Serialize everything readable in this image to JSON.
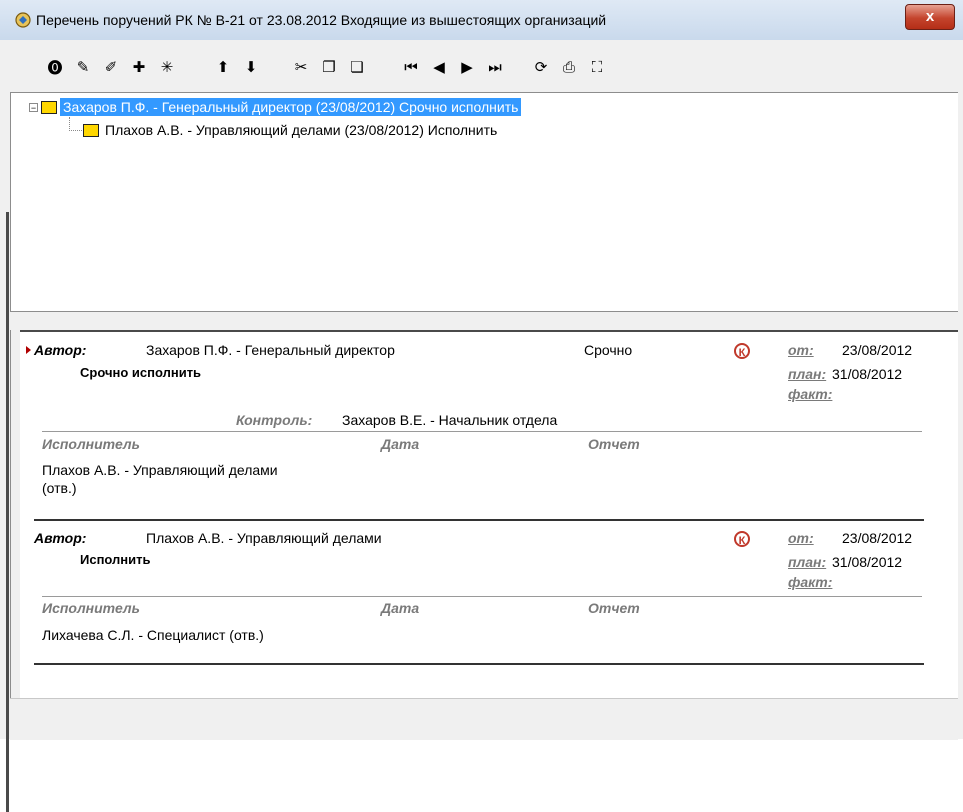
{
  "window": {
    "title": "Перечень поручений РК № В-21 от 23.08.2012 Входящие из вышестоящих организаций",
    "close_label": "x"
  },
  "toolbar": {
    "buttons": [
      {
        "name": "new-task-icon",
        "glyph": "⓿"
      },
      {
        "name": "new-subtask-icon",
        "glyph": "✎"
      },
      {
        "name": "edit-icon",
        "glyph": "✐"
      },
      {
        "name": "save-icon",
        "glyph": "✚"
      },
      {
        "name": "sort-icon",
        "glyph": "✳"
      },
      {
        "name": "move-up-icon",
        "glyph": "⬆"
      },
      {
        "name": "move-down-icon",
        "glyph": "⬇"
      },
      {
        "name": "cut-icon",
        "glyph": "✂"
      },
      {
        "name": "copy-icon",
        "glyph": "❐"
      },
      {
        "name": "paste-icon",
        "glyph": "❏"
      },
      {
        "name": "first-icon",
        "glyph": "⏮"
      },
      {
        "name": "prev-icon",
        "glyph": "◀"
      },
      {
        "name": "next-icon",
        "glyph": "▶"
      },
      {
        "name": "last-icon",
        "glyph": "⏭"
      },
      {
        "name": "refresh-icon",
        "glyph": "⟳"
      },
      {
        "name": "print-icon",
        "glyph": "⎙"
      },
      {
        "name": "select-icon",
        "glyph": "⛶"
      }
    ]
  },
  "tree": {
    "nodes": [
      {
        "label": "Захаров П.Ф. - Генеральный директор (23/08/2012) Срочно исполнить",
        "selected": true
      },
      {
        "label": "Плахов А.В. - Управляющий делами (23/08/2012) Исполнить",
        "selected": false
      }
    ]
  },
  "details": [
    {
      "author_label": "Автор:",
      "author": "Захаров П.Ф. - Генеральный директор",
      "urgency": "Срочно",
      "instruction": "Срочно исполнить",
      "control_icon": "К",
      "from_label": "от:",
      "from_date": "23/08/2012",
      "plan_label": "план:",
      "plan_date": "31/08/2012",
      "fact_label": "факт:",
      "control_label": "Контроль:",
      "controller": "Захаров В.Е. - Начальник отдела",
      "col_executor": "Исполнитель",
      "col_date": "Дата",
      "col_report": "Отчет",
      "executor_line1": "Плахов А.В. - Управляющий делами",
      "executor_line2": "(отв.)"
    },
    {
      "author_label": "Автор:",
      "author": "Плахов А.В. - Управляющий делами",
      "instruction": "Исполнить",
      "control_icon": "К",
      "from_label": "от:",
      "from_date": "23/08/2012",
      "plan_label": "план:",
      "plan_date": "31/08/2012",
      "fact_label": "факт:",
      "col_executor": "Исполнитель",
      "col_date": "Дата",
      "col_report": "Отчет",
      "executor_line1": "Лихачева С.Л. - Специалист (отв.)"
    }
  ],
  "colors": {
    "selection": "#3399ff",
    "control_icon": "#c0392b",
    "folder": "#ffd700"
  }
}
